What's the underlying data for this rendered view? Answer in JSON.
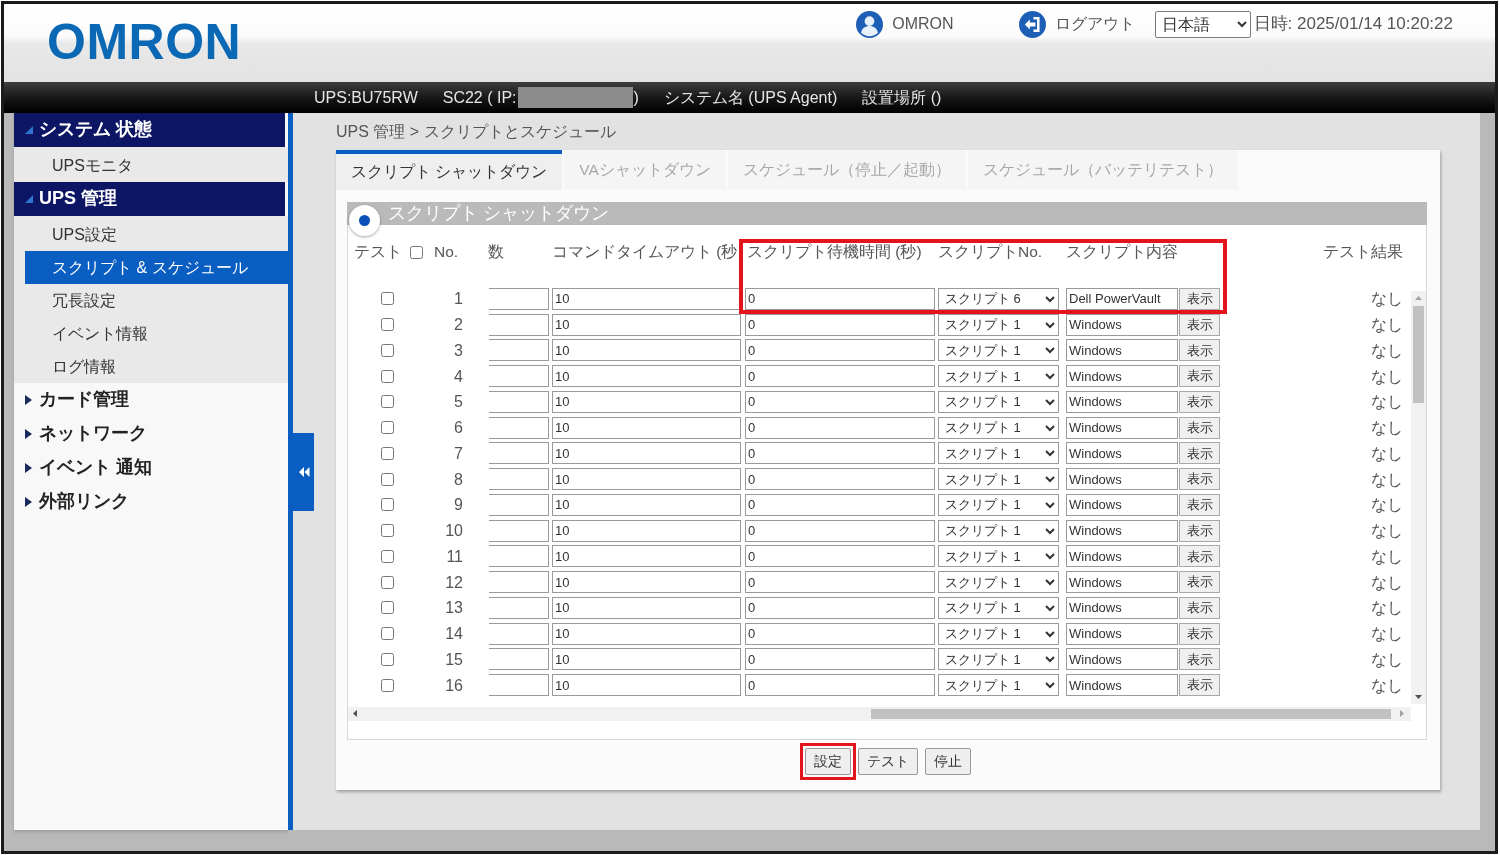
{
  "header": {
    "logo": "OMRON",
    "user": "OMRON",
    "logout": "ログアウト",
    "language": "日本語",
    "datetime": "日時: 2025/01/14 10:20:22"
  },
  "info_bar": {
    "ups": "UPS:BU75RW",
    "ip_prefix": "SC22 ( IP:",
    "ip_suffix": ")",
    "system_name": "システム名 (UPS Agent)",
    "location": "設置場所 ()"
  },
  "sidebar": {
    "groups": [
      {
        "label": "システム 状態",
        "expanded": true,
        "children": [
          {
            "label": "UPSモニタ",
            "selected": false
          }
        ]
      },
      {
        "label": "UPS 管理",
        "expanded": true,
        "children": [
          {
            "label": "UPS設定",
            "selected": false
          },
          {
            "label": "スクリプト & スケジュール",
            "selected": true
          },
          {
            "label": "冗長設定",
            "selected": false
          },
          {
            "label": "イベント情報",
            "selected": false
          },
          {
            "label": "ログ情報",
            "selected": false
          }
        ]
      },
      {
        "label": "カード管理",
        "expanded": false
      },
      {
        "label": "ネットワーク",
        "expanded": false
      },
      {
        "label": "イベント 通知",
        "expanded": false
      },
      {
        "label": "外部リンク",
        "expanded": false
      }
    ]
  },
  "breadcrumb": "UPS 管理 > スクリプトとスケジュール",
  "tabs": [
    {
      "label": "スクリプト シャットダウン",
      "selected": true
    },
    {
      "label": "VAシャットダウン",
      "selected": false
    },
    {
      "label": "スケジュール（停止／起動）",
      "selected": false
    },
    {
      "label": "スケジュール（バッテリテスト）",
      "selected": false
    }
  ],
  "section": {
    "title": "スクリプト シャットダウン",
    "selected": true
  },
  "table": {
    "columns": [
      {
        "kind": "test",
        "label": "テスト",
        "checked": false,
        "highlighted": false
      },
      {
        "kind": "no",
        "label": "No.",
        "highlighted": false
      },
      {
        "kind": "count",
        "label": "数",
        "highlighted": false
      },
      {
        "kind": "timeout",
        "label": "コマンドタイムアウト (秒",
        "highlighted": false
      },
      {
        "kind": "wait",
        "label": "スクリプト待機時間 (秒)",
        "highlighted": true
      },
      {
        "kind": "script",
        "label": "スクリプトNo.",
        "highlighted": true
      },
      {
        "kind": "content",
        "label": "スクリプト内容",
        "highlighted": true
      },
      {
        "kind": "result",
        "label": "テスト結果",
        "highlighted": false
      }
    ],
    "rows": [
      {
        "checked": false,
        "no": "1",
        "timeout": "10",
        "wait": "0",
        "script": "スクリプト 6",
        "content": "Dell PowerVault",
        "action": "表示",
        "result": "なし",
        "highlighted": true
      },
      {
        "checked": false,
        "no": "2",
        "timeout": "10",
        "wait": "0",
        "script": "スクリプト 1",
        "content": "Windows",
        "action": "表示",
        "result": "なし",
        "highlighted": false
      },
      {
        "checked": false,
        "no": "3",
        "timeout": "10",
        "wait": "0",
        "script": "スクリプト 1",
        "content": "Windows",
        "action": "表示",
        "result": "なし",
        "highlighted": false
      },
      {
        "checked": false,
        "no": "4",
        "timeout": "10",
        "wait": "0",
        "script": "スクリプト 1",
        "content": "Windows",
        "action": "表示",
        "result": "なし",
        "highlighted": false
      },
      {
        "checked": false,
        "no": "5",
        "timeout": "10",
        "wait": "0",
        "script": "スクリプト 1",
        "content": "Windows",
        "action": "表示",
        "result": "なし",
        "highlighted": false
      },
      {
        "checked": false,
        "no": "6",
        "timeout": "10",
        "wait": "0",
        "script": "スクリプト 1",
        "content": "Windows",
        "action": "表示",
        "result": "なし",
        "highlighted": false
      },
      {
        "checked": false,
        "no": "7",
        "timeout": "10",
        "wait": "0",
        "script": "スクリプト 1",
        "content": "Windows",
        "action": "表示",
        "result": "なし",
        "highlighted": false
      },
      {
        "checked": false,
        "no": "8",
        "timeout": "10",
        "wait": "0",
        "script": "スクリプト 1",
        "content": "Windows",
        "action": "表示",
        "result": "なし",
        "highlighted": false
      },
      {
        "checked": false,
        "no": "9",
        "timeout": "10",
        "wait": "0",
        "script": "スクリプト 1",
        "content": "Windows",
        "action": "表示",
        "result": "なし",
        "highlighted": false
      },
      {
        "checked": false,
        "no": "10",
        "timeout": "10",
        "wait": "0",
        "script": "スクリプト 1",
        "content": "Windows",
        "action": "表示",
        "result": "なし",
        "highlighted": false
      },
      {
        "checked": false,
        "no": "11",
        "timeout": "10",
        "wait": "0",
        "script": "スクリプト 1",
        "content": "Windows",
        "action": "表示",
        "result": "なし",
        "highlighted": false
      },
      {
        "checked": false,
        "no": "12",
        "timeout": "10",
        "wait": "0",
        "script": "スクリプト 1",
        "content": "Windows",
        "action": "表示",
        "result": "なし",
        "highlighted": false
      },
      {
        "checked": false,
        "no": "13",
        "timeout": "10",
        "wait": "0",
        "script": "スクリプト 1",
        "content": "Windows",
        "action": "表示",
        "result": "なし",
        "highlighted": false
      },
      {
        "checked": false,
        "no": "14",
        "timeout": "10",
        "wait": "0",
        "script": "スクリプト 1",
        "content": "Windows",
        "action": "表示",
        "result": "なし",
        "highlighted": false
      },
      {
        "checked": false,
        "no": "15",
        "timeout": "10",
        "wait": "0",
        "script": "スクリプト 1",
        "content": "Windows",
        "action": "表示",
        "result": "なし",
        "highlighted": false
      },
      {
        "checked": false,
        "no": "16",
        "timeout": "10",
        "wait": "0",
        "script": "スクリプト 1",
        "content": "Windows",
        "action": "表示",
        "result": "なし",
        "highlighted": false
      }
    ]
  },
  "buttons": [
    {
      "label": "設定",
      "highlighted": true
    },
    {
      "label": "テスト",
      "highlighted": false
    },
    {
      "label": "停止",
      "highlighted": false
    }
  ]
}
